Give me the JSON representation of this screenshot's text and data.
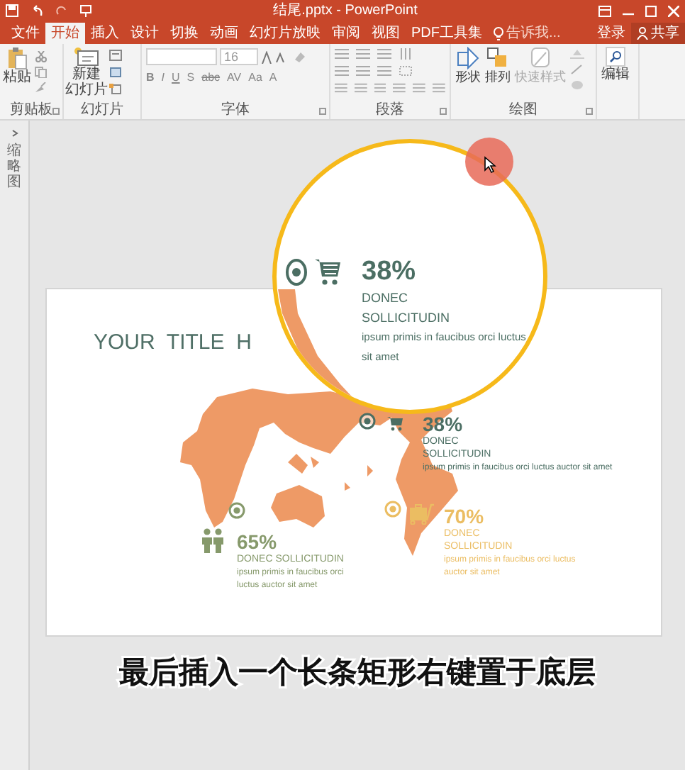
{
  "window": {
    "title": "结尾.pptx - PowerPoint"
  },
  "tabs": [
    {
      "label": "文件",
      "selected": false
    },
    {
      "label": "开始",
      "selected": true
    },
    {
      "label": "插入",
      "selected": false
    },
    {
      "label": "设计",
      "selected": false
    },
    {
      "label": "切换",
      "selected": false
    },
    {
      "label": "动画",
      "selected": false
    },
    {
      "label": "幻灯片放映",
      "selected": false
    },
    {
      "label": "审阅",
      "selected": false
    },
    {
      "label": "视图",
      "selected": false
    },
    {
      "label": "PDF工具集",
      "selected": false
    }
  ],
  "tell_me": {
    "placeholder": "告诉我..."
  },
  "account": {
    "sign_in": "登录",
    "share": "共享"
  },
  "ribbon": {
    "groups": [
      {
        "label": "剪贴板"
      },
      {
        "label": "幻灯片"
      },
      {
        "label": "字体"
      },
      {
        "label": "段落"
      },
      {
        "label": "绘图"
      }
    ],
    "paste": {
      "label": "粘贴"
    },
    "new_slide": {
      "label_lines": [
        "新建",
        "幻灯片"
      ]
    },
    "font": {
      "size": "16",
      "format_buttons": [
        "B",
        "I",
        "U",
        "S",
        "abc",
        "AV",
        "Aa",
        "A"
      ]
    },
    "drawing_buttons": [
      {
        "label": "形状",
        "disabled": false
      },
      {
        "label": "排列",
        "disabled": false
      },
      {
        "label": "快速样式",
        "disabled": true
      }
    ],
    "editing": {
      "label": "编辑"
    }
  },
  "thumbnail_pane": {
    "label": "缩略图"
  },
  "slide": {
    "title": "YOUR  TITLE  H",
    "callouts": [
      {
        "kind": "cart",
        "percent": "38%",
        "heading_lines": [
          "DONEC",
          "SOLLICITUDIN"
        ],
        "body": "ipsum primis in faucibus orci luctus auctor sit amet",
        "color": "#4b6e63"
      },
      {
        "kind": "luggage",
        "percent": "70%",
        "heading_lines": [
          "DONEC",
          "SOLLICITUDIN"
        ],
        "body": "ipsum primis in faucibus orci luctus auctor sit amet",
        "color": "#ebbd62"
      },
      {
        "kind": "people",
        "percent": "65%",
        "heading_lines": [
          "DONEC SOLLICITUDIN"
        ],
        "body": "ipsum primis in faucibus orci luctus auctor sit amet",
        "color": "#86996b"
      }
    ]
  },
  "magnifier": {
    "percent": "38%",
    "heading_lines": [
      "DONEC",
      "SOLLICITUDIN"
    ],
    "body_lines": [
      "ipsum primis in faucibus orci luctus",
      "sit amet"
    ]
  },
  "caption": "最后插入一个长条矩形右键置于底层"
}
